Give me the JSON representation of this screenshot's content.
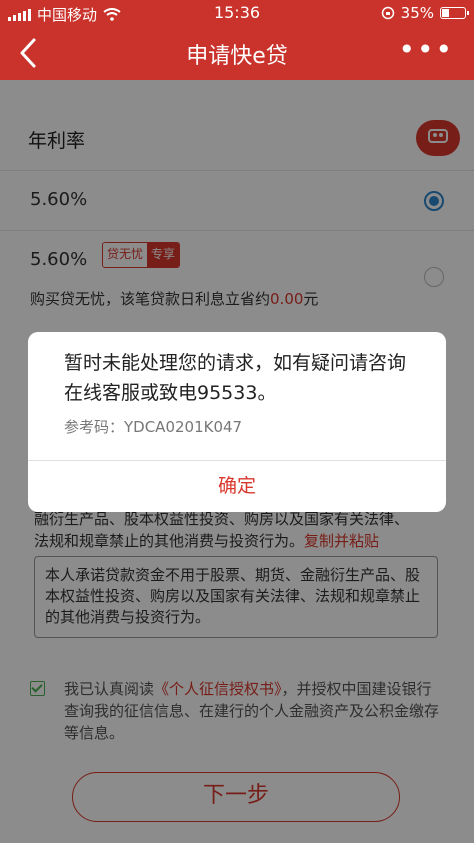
{
  "status_bar": {
    "carrier": "中国移动",
    "time": "15:36",
    "battery_text": "35%",
    "battery_level": 0.35
  },
  "nav": {
    "title": "申请快e贷",
    "back_icon": "chevron-left-icon",
    "more_icon": "more-dots-icon",
    "more_label": "•••"
  },
  "rate": {
    "label": "年利率",
    "options": [
      {
        "value": "5.60%",
        "selected": true
      },
      {
        "value": "5.60%",
        "selected": false,
        "tag_a": "贷无忧",
        "tag_b": "专享"
      }
    ],
    "save_note_prefix": "购买贷无忧，该笔贷款日利息立省约",
    "save_amount": "0.00",
    "save_unit": "元"
  },
  "commitment": {
    "partial_text_line1": "融衍生产品、股本权益性投资、购房以及国家有关法律、",
    "partial_text_line2": "法规和规章禁止的其他消费与投资行为。",
    "copy_paste": "复制并粘贴",
    "box_text": "本人承诺贷款资金不用于股票、期货、金融衍生产品、股本权益性投资、购房以及国家有关法律、法规和规章禁止的其他消费与投资行为。"
  },
  "agreement": {
    "prefix": "我已认真阅读",
    "link": "《个人征信授权书》",
    "suffix": "，并授权中国建设银行查询我的征信信息、在建行的个人金融资产及公积金缴存等信息。"
  },
  "next_button": "下一步",
  "dialog": {
    "message": "暂时未能处理您的请求，如有疑问请咨询在线客服或致电95533。",
    "reference": "参考码：YDCA0201K047",
    "confirm": "确定"
  },
  "colors": {
    "brand_red": "#c9332c",
    "accent_red": "#d9372c",
    "radio_blue": "#2c86cc",
    "check_green": "#4caf50"
  }
}
